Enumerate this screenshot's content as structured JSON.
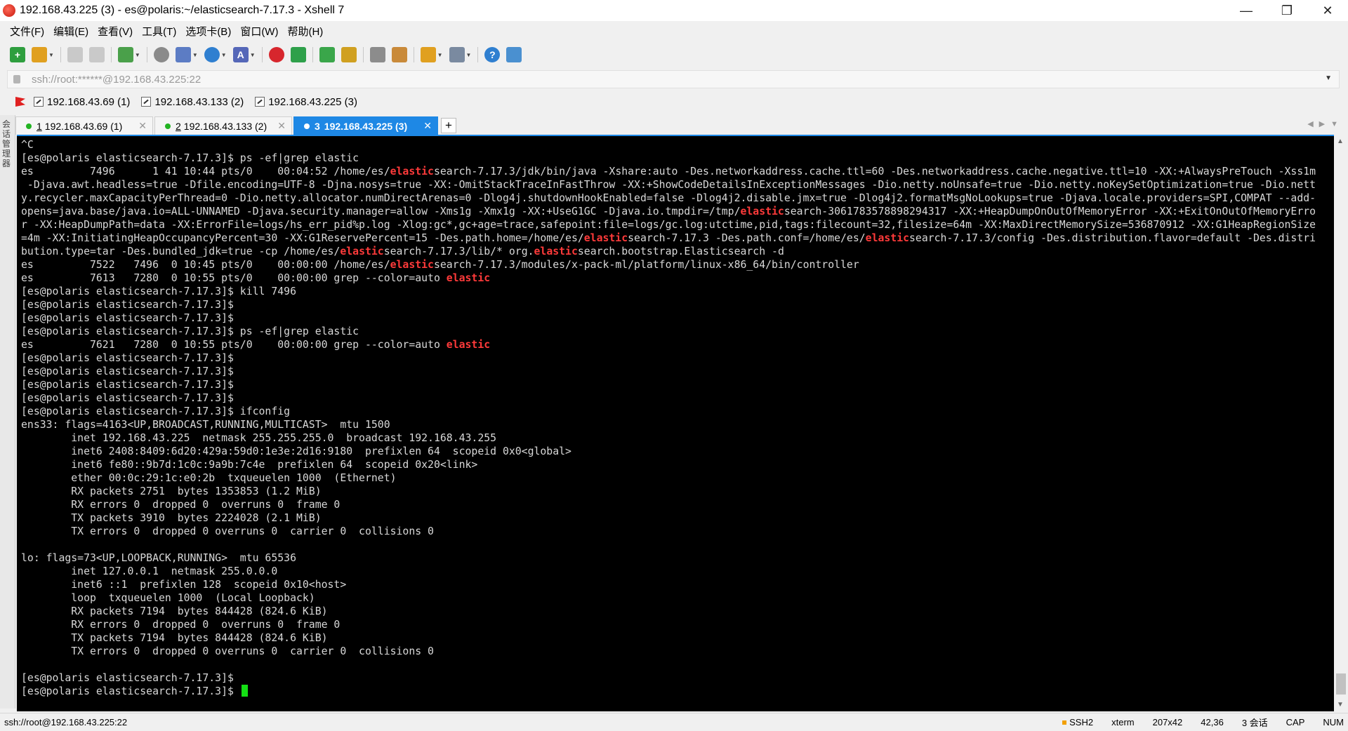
{
  "window": {
    "title": "192.168.43.225 (3) - es@polaris:~/elasticsearch-7.17.3 - Xshell 7",
    "controls": {
      "minimize": "—",
      "restore": "❐",
      "close": "✕"
    }
  },
  "menu": [
    "文件(F)",
    "编辑(E)",
    "查看(V)",
    "工具(T)",
    "选项卡(B)",
    "窗口(W)",
    "帮助(H)"
  ],
  "toolbar": {
    "icons": [
      "new-session",
      "open",
      "disconnect",
      "reconnect",
      "properties",
      "find",
      "transfer",
      "globe",
      "font",
      "xftp",
      "xmanager",
      "fullscreen",
      "lock",
      "keyboard",
      "script",
      "compose",
      "layout",
      "help",
      "chat"
    ]
  },
  "address": {
    "url": "ssh://root:******@192.168.43.225:22"
  },
  "sessions": {
    "links": [
      "192.168.43.69 (1)",
      "192.168.43.133 (2)",
      "192.168.43.225 (3)"
    ]
  },
  "side": {
    "label": "会话管理器"
  },
  "tabs": [
    {
      "num": "1",
      "label": "192.168.43.69 (1)",
      "active": false
    },
    {
      "num": "2",
      "label": "192.168.43.133 (2)",
      "active": false
    },
    {
      "num": "3",
      "label": "192.168.43.225 (3)",
      "active": true
    }
  ],
  "tab_add": "+",
  "terminal": {
    "highlight_word": "elastic",
    "lines": [
      "^C",
      "[es@polaris elasticsearch-7.17.3]$ ps -ef|grep elastic",
      "es         7496      1 41 10:44 pts/0    00:04:52 /home/es/elasticsearch-7.17.3/jdk/bin/java -Xshare:auto -Des.networkaddress.cache.ttl=60 -Des.networkaddress.cache.negative.ttl=10 -XX:+AlwaysPreTouch -Xss1m",
      " -Djava.awt.headless=true -Dfile.encoding=UTF-8 -Djna.nosys=true -XX:-OmitStackTraceInFastThrow -XX:+ShowCodeDetailsInExceptionMessages -Dio.netty.noUnsafe=true -Dio.netty.noKeySetOptimization=true -Dio.nett",
      "y.recycler.maxCapacityPerThread=0 -Dio.netty.allocator.numDirectArenas=0 -Dlog4j.shutdownHookEnabled=false -Dlog4j2.disable.jmx=true -Dlog4j2.formatMsgNoLookups=true -Djava.locale.providers=SPI,COMPAT --add-",
      "opens=java.base/java.io=ALL-UNNAMED -Djava.security.manager=allow -Xms1g -Xmx1g -XX:+UseG1GC -Djava.io.tmpdir=/tmp/elasticsearch-3061783578898294317 -XX:+HeapDumpOnOutOfMemoryError -XX:+ExitOnOutOfMemoryErro",
      "r -XX:HeapDumpPath=data -XX:ErrorFile=logs/hs_err_pid%p.log -Xlog:gc*,gc+age=trace,safepoint:file=logs/gc.log:utctime,pid,tags:filecount=32,filesize=64m -XX:MaxDirectMemorySize=536870912 -XX:G1HeapRegionSize",
      "=4m -XX:InitiatingHeapOccupancyPercent=30 -XX:G1ReservePercent=15 -Des.path.home=/home/es/elasticsearch-7.17.3 -Des.path.conf=/home/es/elasticsearch-7.17.3/config -Des.distribution.flavor=default -Des.distri",
      "bution.type=tar -Des.bundled_jdk=true -cp /home/es/elasticsearch-7.17.3/lib/* org.elasticsearch.bootstrap.Elasticsearch -d",
      "es         7522   7496  0 10:45 pts/0    00:00:00 /home/es/elasticsearch-7.17.3/modules/x-pack-ml/platform/linux-x86_64/bin/controller",
      "es         7613   7280  0 10:55 pts/0    00:00:00 grep --color=auto elastic",
      "[es@polaris elasticsearch-7.17.3]$ kill 7496",
      "[es@polaris elasticsearch-7.17.3]$",
      "[es@polaris elasticsearch-7.17.3]$",
      "[es@polaris elasticsearch-7.17.3]$ ps -ef|grep elastic",
      "es         7621   7280  0 10:55 pts/0    00:00:00 grep --color=auto elastic",
      "[es@polaris elasticsearch-7.17.3]$",
      "[es@polaris elasticsearch-7.17.3]$",
      "[es@polaris elasticsearch-7.17.3]$",
      "[es@polaris elasticsearch-7.17.3]$",
      "[es@polaris elasticsearch-7.17.3]$ ifconfig",
      "ens33: flags=4163<UP,BROADCAST,RUNNING,MULTICAST>  mtu 1500",
      "        inet 192.168.43.225  netmask 255.255.255.0  broadcast 192.168.43.255",
      "        inet6 2408:8409:6d20:429a:59d0:1e3e:2d16:9180  prefixlen 64  scopeid 0x0<global>",
      "        inet6 fe80::9b7d:1c0c:9a9b:7c4e  prefixlen 64  scopeid 0x20<link>",
      "        ether 00:0c:29:1c:e0:2b  txqueuelen 1000  (Ethernet)",
      "        RX packets 2751  bytes 1353853 (1.2 MiB)",
      "        RX errors 0  dropped 0  overruns 0  frame 0",
      "        TX packets 3910  bytes 2224028 (2.1 MiB)",
      "        TX errors 0  dropped 0 overruns 0  carrier 0  collisions 0",
      "",
      "lo: flags=73<UP,LOOPBACK,RUNNING>  mtu 65536",
      "        inet 127.0.0.1  netmask 255.0.0.0",
      "        inet6 ::1  prefixlen 128  scopeid 0x10<host>",
      "        loop  txqueuelen 1000  (Local Loopback)",
      "        RX packets 7194  bytes 844428 (824.6 KiB)",
      "        RX errors 0  dropped 0  overruns 0  frame 0",
      "        TX packets 7194  bytes 844428 (824.6 KiB)",
      "        TX errors 0  dropped 0 overruns 0  carrier 0  collisions 0",
      "",
      "[es@polaris elasticsearch-7.17.3]$",
      "[es@polaris elasticsearch-7.17.3]$ "
    ],
    "highlight_lines": [
      2,
      3,
      4,
      5,
      6,
      7,
      8,
      9,
      10,
      15
    ]
  },
  "status": {
    "left": "ssh://root@192.168.43.225:22",
    "protocol": "SSH2",
    "term": "xterm",
    "size": "207x42",
    "cursor_pos": "42,36",
    "sessions": "3 会话",
    "caps": "CAP",
    "num": "NUM"
  },
  "colors": {
    "accent": "#1e88e5",
    "highlight": "#ff3a3a",
    "cursor": "#14e014"
  }
}
